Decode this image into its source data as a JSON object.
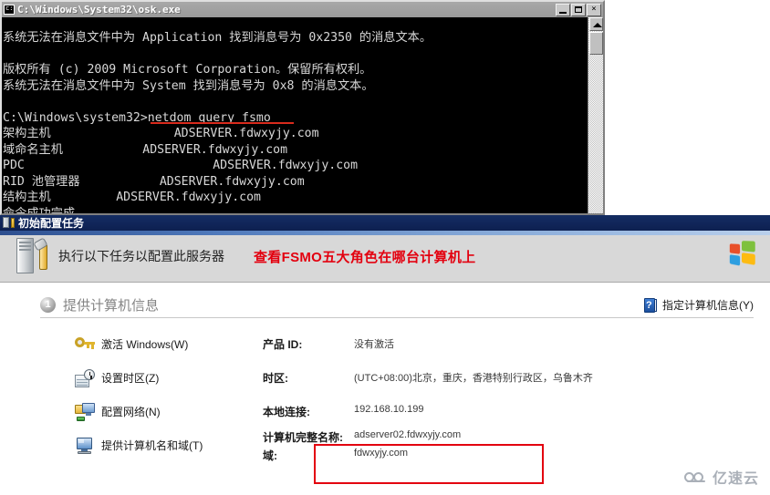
{
  "console": {
    "title": "C:\\Windows\\System32\\osk.exe",
    "icon": "cmd-icon",
    "window_buttons": {
      "minimize": "_",
      "maximize": "□",
      "close": "×"
    },
    "output": "系统无法在消息文件中为 Application 找到消息号为 0x2350 的消息文本。\n\n版权所有 (c) 2009 Microsoft Corporation。保留所有权利。\n系统无法在消息文件中为 System 找到消息号为 0x8 的消息文本。\n\nC:\\Windows\\system32>netdom query fsmo\n架构主机                 ADSERVER.fdwxyjy.com\n域命名主机           ADSERVER.fdwxyjy.com\nPDC                          ADSERVER.fdwxyjy.com\nRID 池管理器           ADSERVER.fdwxyjy.com\n结构主机         ADSERVER.fdwxyjy.com\n命令成功完成。",
    "command": "netdom query fsmo",
    "prompt": "C:\\Windows\\system32>",
    "fsmo_roles": [
      {
        "role": "架构主机",
        "holder": "ADSERVER.fdwxyjy.com"
      },
      {
        "role": "域命名主机",
        "holder": "ADSERVER.fdwxyjy.com"
      },
      {
        "role": "PDC",
        "holder": "ADSERVER.fdwxyjy.com"
      },
      {
        "role": "RID 池管理器",
        "holder": "ADSERVER.fdwxyjy.com"
      },
      {
        "role": "结构主机",
        "holder": "ADSERVER.fdwxyjy.com"
      }
    ],
    "result": "命令成功完成。",
    "scrollbar": {
      "up_arrow": "▲"
    }
  },
  "ict": {
    "title": "初始配置任务",
    "header_text": "执行以下任务以配置此服务器",
    "annotation": "查看FSMO五大角色在哪台计算机上",
    "logo": "windows-flag"
  },
  "section": {
    "number": "1",
    "title": "提供计算机信息",
    "help_link": "指定计算机信息(Y)"
  },
  "tasks": [
    {
      "icon": "key-icon",
      "label": "激活 Windows(W)",
      "field_label": "产品 ID:",
      "field_value": "没有激活"
    },
    {
      "icon": "timezone-icon",
      "label": "设置时区(Z)",
      "field_label": "时区:",
      "field_value": "(UTC+08:00)北京，重庆，香港特别行政区，乌鲁木齐"
    },
    {
      "icon": "network-icon",
      "label": "配置网络(N)",
      "field_label": "本地连接:",
      "field_value": "192.168.10.199"
    },
    {
      "icon": "computer-icon",
      "label": "提供计算机名和域(T)",
      "field_label": "计算机完整名称:",
      "field_value": "adserver02.fdwxyjy.com",
      "field_label2": "域:",
      "field_value2": "fdwxyjy.com"
    }
  ],
  "watermark": {
    "text": "亿速云"
  },
  "colors": {
    "annotation_red": "#e3000f",
    "highlight_box": "#e3000f",
    "titlebar_blue": "#11265a",
    "console_bg": "#000000",
    "console_fg": "#d8d8d8"
  }
}
